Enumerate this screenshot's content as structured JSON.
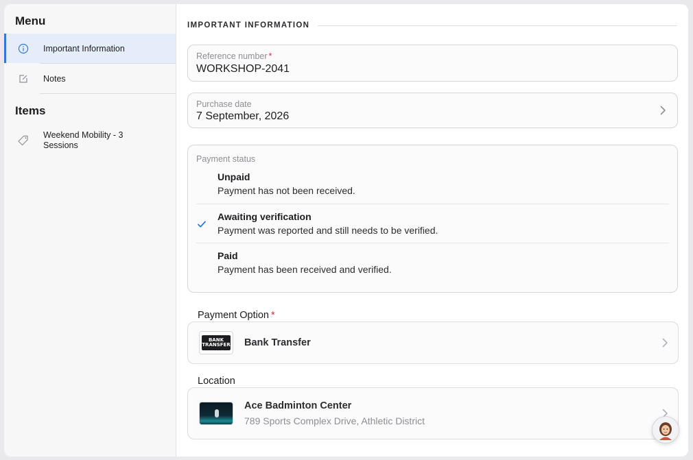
{
  "sidebar": {
    "menu_title": "Menu",
    "items_title": "Items",
    "menu_items": [
      {
        "label": "Important Information",
        "icon": "info-icon"
      },
      {
        "label": "Notes",
        "icon": "edit-icon"
      }
    ],
    "products": [
      {
        "label": "Weekend Mobility - 3 Sessions",
        "icon": "tag-icon"
      }
    ]
  },
  "main": {
    "section_title": "IMPORTANT INFORMATION",
    "reference": {
      "label": "Reference number",
      "required_mark": "*",
      "value": "WORKSHOP-2041"
    },
    "purchase_date": {
      "label": "Purchase date",
      "value": "7 September, 2026"
    },
    "payment_status": {
      "label": "Payment status",
      "selected": "Awaiting verification",
      "options": [
        {
          "title": "Unpaid",
          "description": "Payment has not been received."
        },
        {
          "title": "Awaiting verification",
          "description": "Payment was reported and still needs to be verified."
        },
        {
          "title": "Paid",
          "description": "Payment has been received and verified."
        }
      ]
    },
    "payment_option": {
      "label": "Payment Option",
      "required_mark": "*",
      "value": "Bank Transfer",
      "logo_text": "BANK TRANSFER"
    },
    "location": {
      "label": "Location",
      "name": "Ace Badminton Center",
      "address": "789 Sports Complex Drive, Athletic District"
    }
  },
  "colors": {
    "accent": "#3478d4",
    "selected_bg": "#e4edf9",
    "required": "#d92d3a"
  }
}
